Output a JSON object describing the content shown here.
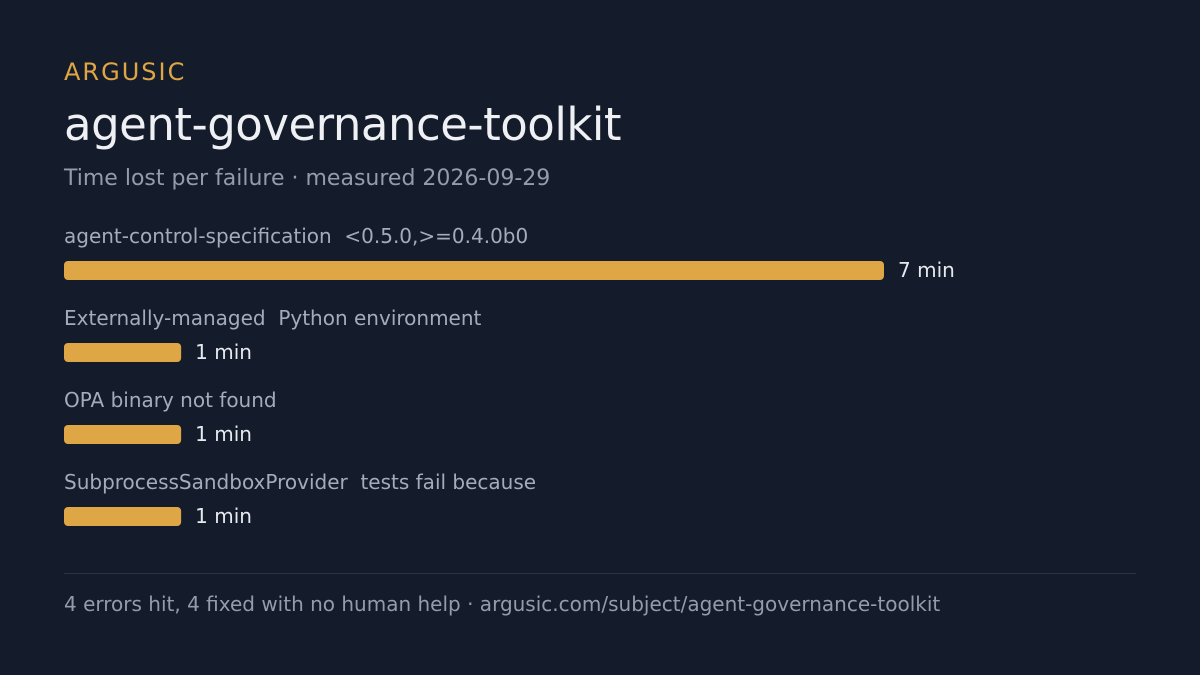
{
  "header": {
    "brand": "ARGUSIC",
    "title": "agent-governance-toolkit",
    "subtitle": "Time lost per failure · measured 2026-09-29"
  },
  "colors": {
    "background": "#141b2b",
    "bar": "#dfa645",
    "brand": "#dfa645"
  },
  "chart_data": {
    "type": "bar",
    "orientation": "horizontal",
    "categories": [
      "agent-control-specification  <0.5.0,>=0.4.0b0",
      "Externally-managed  Python environment",
      "OPA binary not found",
      "SubprocessSandboxProvider  tests fail because"
    ],
    "values": [
      7,
      1,
      1,
      1
    ],
    "value_labels": [
      "7 min",
      "1 min",
      "1 min",
      "1 min"
    ],
    "xlim": [
      0,
      7
    ],
    "grid": false
  },
  "footer": {
    "text": "4 errors hit, 4 fixed with no human help · argusic.com/subject/agent-governance-toolkit"
  }
}
